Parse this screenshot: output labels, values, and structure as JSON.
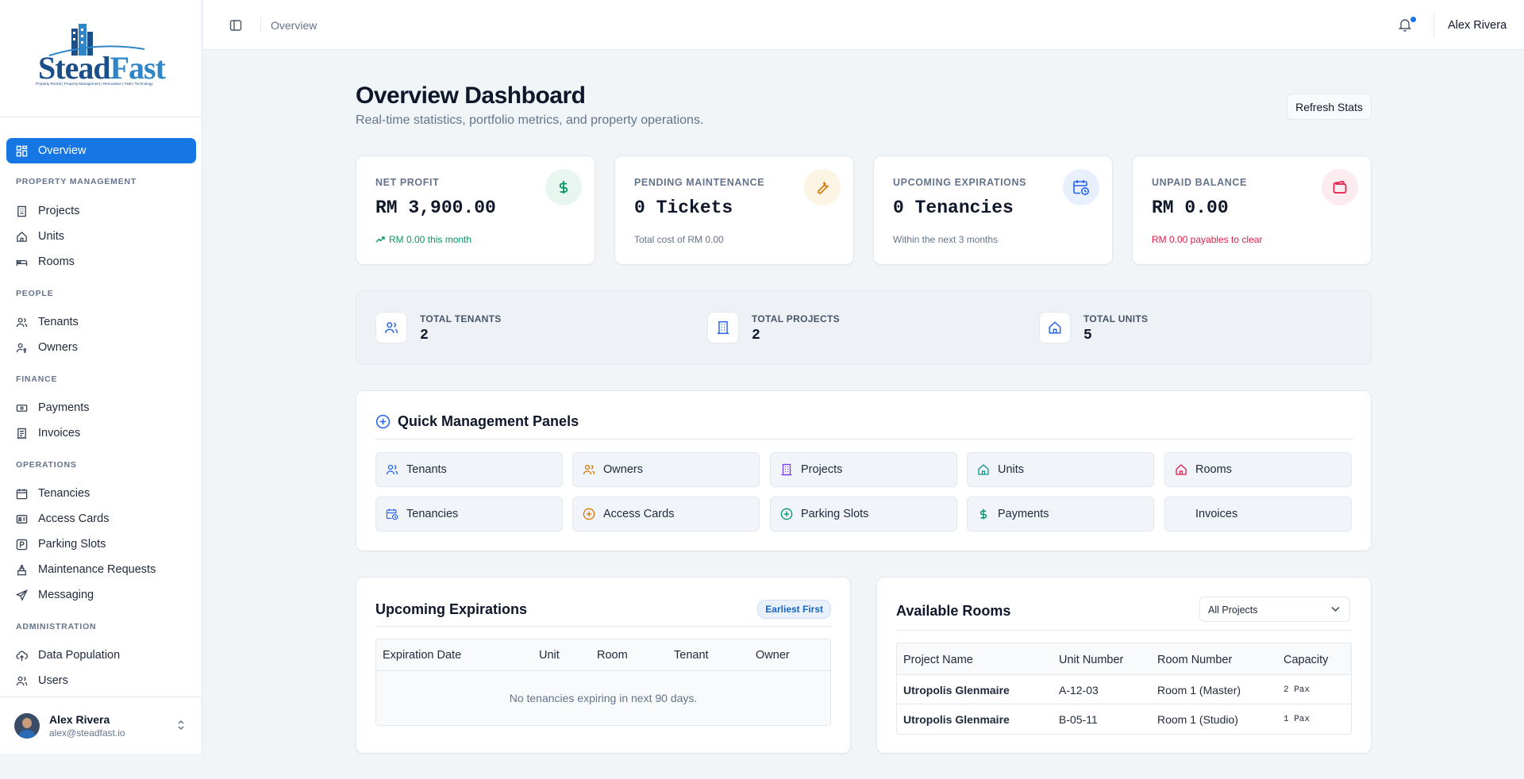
{
  "brand": {
    "logo_part1": "Stead",
    "logo_part2": "Fast",
    "tagline": "Property Rental | Property Management | Renovation | F&B | Technology"
  },
  "sidebar": {
    "active": "Overview",
    "sections": {
      "property_management": "PROPERTY MANAGEMENT",
      "people": "PEOPLE",
      "finance": "FINANCE",
      "operations": "OPERATIONS",
      "administration": "ADMINISTRATION"
    },
    "items": {
      "overview": "Overview",
      "projects": "Projects",
      "units": "Units",
      "rooms": "Rooms",
      "tenants": "Tenants",
      "owners": "Owners",
      "payments": "Payments",
      "invoices": "Invoices",
      "tenancies": "Tenancies",
      "access_cards": "Access Cards",
      "parking_slots": "Parking Slots",
      "maintenance_requests": "Maintenance Requests",
      "messaging": "Messaging",
      "data_population": "Data Population",
      "users": "Users"
    },
    "user": {
      "name": "Alex Rivera",
      "email": "alex@steadfast.io"
    }
  },
  "topbar": {
    "breadcrumb": "Overview",
    "user_name": "Alex Rivera"
  },
  "header": {
    "title": "Overview Dashboard",
    "subtitle": "Real-time statistics, portfolio metrics, and property operations.",
    "refresh_label": "Refresh Stats"
  },
  "cards": {
    "net_profit": {
      "label": "NET PROFIT",
      "value": "RM 3,900.00",
      "note": "RM 0.00 this month",
      "color": "#059669"
    },
    "pending_maintenance": {
      "label": "PENDING MAINTENANCE",
      "value": "0 Tickets",
      "note": "Total cost of RM 0.00",
      "color": "#d97706"
    },
    "upcoming_expirations": {
      "label": "UPCOMING EXPIRATIONS",
      "value": "0 Tenancies",
      "note": "Within the next 3 months",
      "color": "#2563eb"
    },
    "unpaid_balance": {
      "label": "UNPAID BALANCE",
      "value": "RM 0.00",
      "note": "RM 0.00 payables to clear",
      "color": "#e11d48"
    }
  },
  "stats": {
    "tenants": {
      "label": "TOTAL TENANTS",
      "value": "2"
    },
    "projects": {
      "label": "TOTAL PROJECTS",
      "value": "2"
    },
    "units": {
      "label": "TOTAL UNITS",
      "value": "5"
    }
  },
  "quick_panels": {
    "title": "Quick Management Panels",
    "buttons": {
      "tenants": "Tenants",
      "owners": "Owners",
      "projects": "Projects",
      "units": "Units",
      "rooms": "Rooms",
      "tenancies": "Tenancies",
      "access_cards": "Access Cards",
      "parking_slots": "Parking Slots",
      "payments": "Payments",
      "invoices": "Invoices"
    }
  },
  "expirations": {
    "title": "Upcoming Expirations",
    "badge": "Earliest First",
    "columns": [
      "Expiration Date",
      "Unit",
      "Room",
      "Tenant",
      "Owner"
    ],
    "empty": "No tenancies expiring in next 90 days."
  },
  "available_rooms": {
    "title": "Available Rooms",
    "filter": "All Projects",
    "columns": [
      "Project Name",
      "Unit Number",
      "Room Number",
      "Capacity"
    ],
    "rows": [
      [
        "Utropolis Glenmaire",
        "A-12-03",
        "Room 1 (Master)",
        "2 Pax"
      ],
      [
        "Utropolis Glenmaire",
        "B-05-11",
        "Room 1 (Studio)",
        "1 Pax"
      ]
    ]
  }
}
